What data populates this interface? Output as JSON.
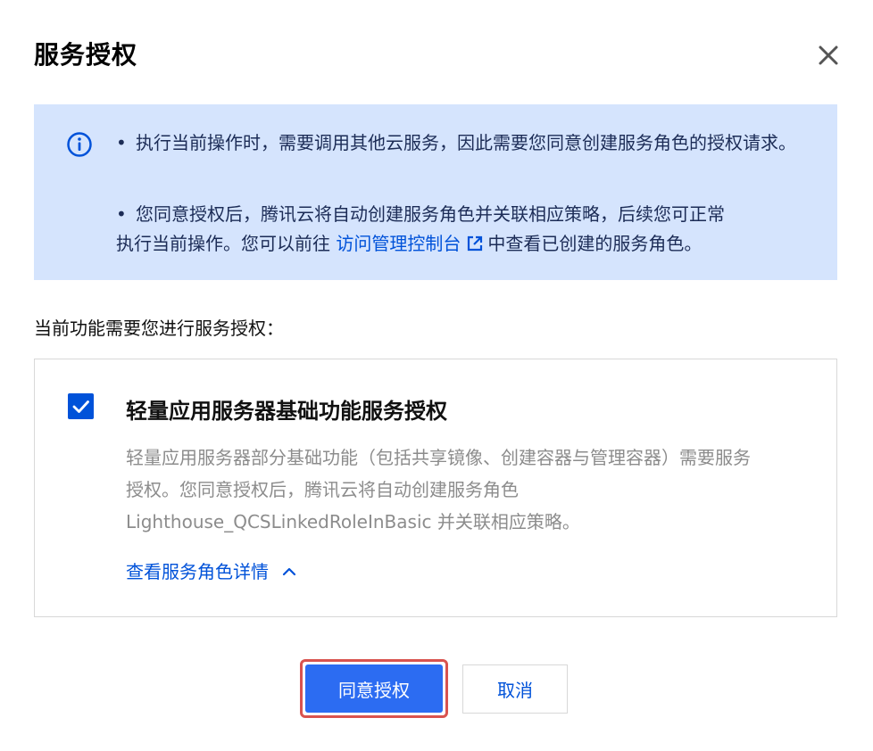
{
  "dialog": {
    "title": "服务授权",
    "close_icon": "close-icon"
  },
  "notice": {
    "icon": "info-icon",
    "bullet": "•",
    "item1": "执行当前操作时，需要调用其他云服务，因此需要您同意创建服务角色的授权请求。",
    "item2_line1": "您同意授权后，腾讯云将自动创建服务角色并关联相应策略，后续您可正常",
    "item2_line2_before": "执行当前操作。您可以前往 ",
    "item2_link": "访问管理控制台",
    "item2_line2_after": "中查看已创建的服务角色。",
    "link_icon": "external-link-icon",
    "bg_color": "#d5e4fd",
    "text_color": "#1c2c56"
  },
  "prompt": "当前功能需要您进行服务授权：",
  "authorization": {
    "checked": true,
    "title": "轻量应用服务器基础功能服务授权",
    "description_line1": "轻量应用服务器部分基础功能（包括共享镜像、创建容器与管理容器）需要服务",
    "description_line2": "授权。您同意授权后，腾讯云将自动创建服务角色",
    "description_line3": "Lighthouse_QCSLinkedRoleInBasic 并关联相应策略。",
    "details_link": "查看服务角色详情",
    "details_icon": "chevron-up-icon"
  },
  "buttons": {
    "agree": "同意授权",
    "cancel": "取消"
  },
  "colors": {
    "primary": "#0052d9",
    "agree_button": "#2c6cf2",
    "highlight_border": "#d9534f"
  }
}
